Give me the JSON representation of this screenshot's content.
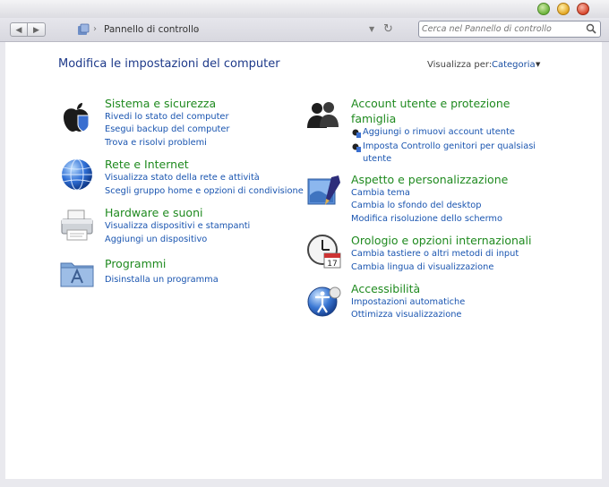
{
  "window": {
    "address": {
      "path": "Pannello di controllo"
    },
    "search": {
      "placeholder": "Cerca nel Pannello di controllo"
    }
  },
  "page": {
    "title": "Modifica le impostazioni del computer",
    "view_by_label": "Visualizza per:",
    "view_by_value": "Categoria"
  },
  "categories": {
    "system": {
      "title": "Sistema e sicurezza",
      "links": [
        "Rivedi lo stato del computer",
        "Esegui backup del computer",
        "Trova e risolvi problemi"
      ]
    },
    "network": {
      "title": "Rete e Internet",
      "links": [
        "Visualizza stato della rete e attività",
        "Scegli gruppo home e opzioni di condivisione"
      ]
    },
    "hardware": {
      "title": "Hardware e suoni",
      "links": [
        "Visualizza dispositivi e stampanti",
        "Aggiungi un dispositivo"
      ]
    },
    "programs": {
      "title": "Programmi",
      "links": [
        "Disinstalla un programma"
      ]
    },
    "accounts": {
      "title_line1": "Account utente e protezione",
      "title_line2": "famiglia",
      "links": [
        "Aggiungi o rimuovi account utente",
        "Imposta Controllo genitori per qualsiasi",
        "utente"
      ]
    },
    "appearance": {
      "title": "Aspetto e personalizzazione",
      "links": [
        "Cambia tema",
        "Cambia lo sfondo del desktop",
        "Modifica risoluzione dello schermo"
      ]
    },
    "clock": {
      "title": "Orologio e opzioni internazionali",
      "links": [
        "Cambia tastiere o altri metodi di input",
        "Cambia lingua di visualizzazione"
      ]
    },
    "access": {
      "title": "Accessibilità",
      "links": [
        "Impostazioni automatiche",
        "Ottimizza visualizzazione"
      ]
    }
  },
  "colors": {
    "category_title": "#1f8a1f",
    "link": "#1a55b0",
    "page_title": "#1e3a8a"
  }
}
